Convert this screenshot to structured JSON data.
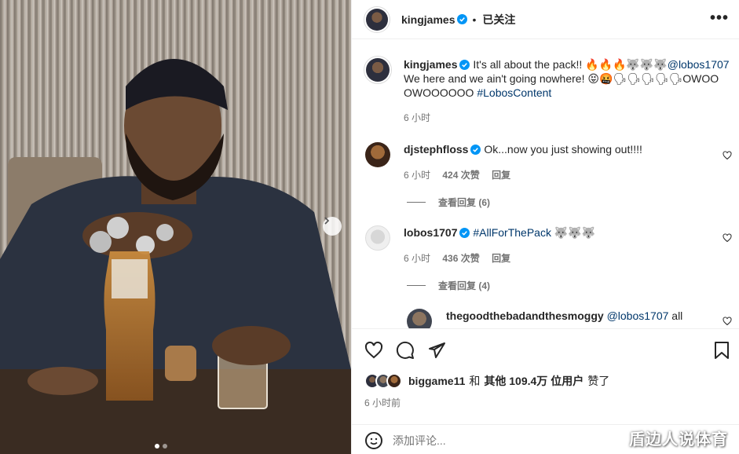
{
  "post": {
    "author": "kingjames",
    "follow_status": "已关注",
    "caption_line1": "It's all about the pack!! 🔥🔥🔥🐺🐺🐺",
    "caption_mention": "@lobos1707",
    "caption_line2": "We here and we ain't going nowhere! 😝🤬🗣🗣🗣🗣🗣OWOO",
    "caption_line3": "OWOOOOOO",
    "caption_hashtag": "#LobosContent",
    "caption_time": "6 小时"
  },
  "comments": [
    {
      "user": "djstephfloss",
      "text": "Ok...now you just showing out!!!!",
      "time": "6 小时",
      "likes": "424 次赞",
      "reply": "回复",
      "view_replies": "查看回复 (6)"
    },
    {
      "user": "lobos1707",
      "text_tag": "#AllForThePack",
      "text_emoji": "🐺🐺🐺",
      "time": "6 小时",
      "likes": "436 次赞",
      "reply": "回复",
      "view_replies": "查看回复 (4)"
    },
    {
      "user": "thegoodthebadandthesmoggy",
      "mention": "@lobos1707",
      "text": "all"
    }
  ],
  "likes_summary": {
    "user": "biggame11",
    "and": "和",
    "others": "其他 109.4万 位用户",
    "liked": "赞了"
  },
  "post_time": "6 小时前",
  "add_comment_placeholder": "添加评论...",
  "watermark": "盾边人说体育",
  "carousel": {
    "current": 1,
    "total": 2
  },
  "colors": {
    "link": "#00376b",
    "verified": "#0095f6",
    "muted": "#737373"
  }
}
